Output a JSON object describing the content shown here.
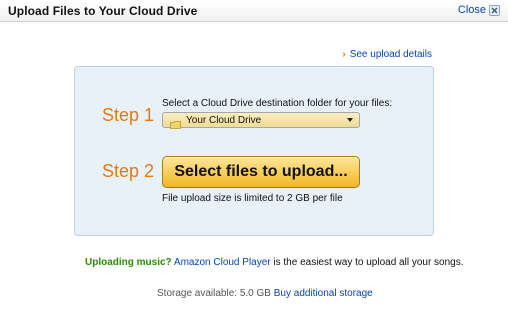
{
  "window": {
    "title": "Upload Files to Your Cloud Drive",
    "close_label": "Close"
  },
  "details_link": {
    "label": "See upload details",
    "icon": "right-arrow-icon",
    "icon_color": "#e47911"
  },
  "step1": {
    "label": "Step 1",
    "instruction": "Select a Cloud Drive destination folder for your files:",
    "selected_folder": "Your Cloud Drive",
    "icon": "folder-icon"
  },
  "step2": {
    "label": "Step 2",
    "button_label": "Select files to upload...",
    "limit_note": "File upload size is limited to 2 GB per file"
  },
  "music": {
    "question": "Uploading music?",
    "player_link": "Amazon Cloud Player",
    "text": "is the easiest way to upload all your songs."
  },
  "storage": {
    "available_text": "Storage available: 5.0 GB",
    "buy_link": "Buy additional storage"
  },
  "colors": {
    "accent_orange": "#e47911",
    "link_blue": "#0645ad",
    "music_green": "#2a8c0a",
    "panel_bg": "#e8f0f8"
  }
}
